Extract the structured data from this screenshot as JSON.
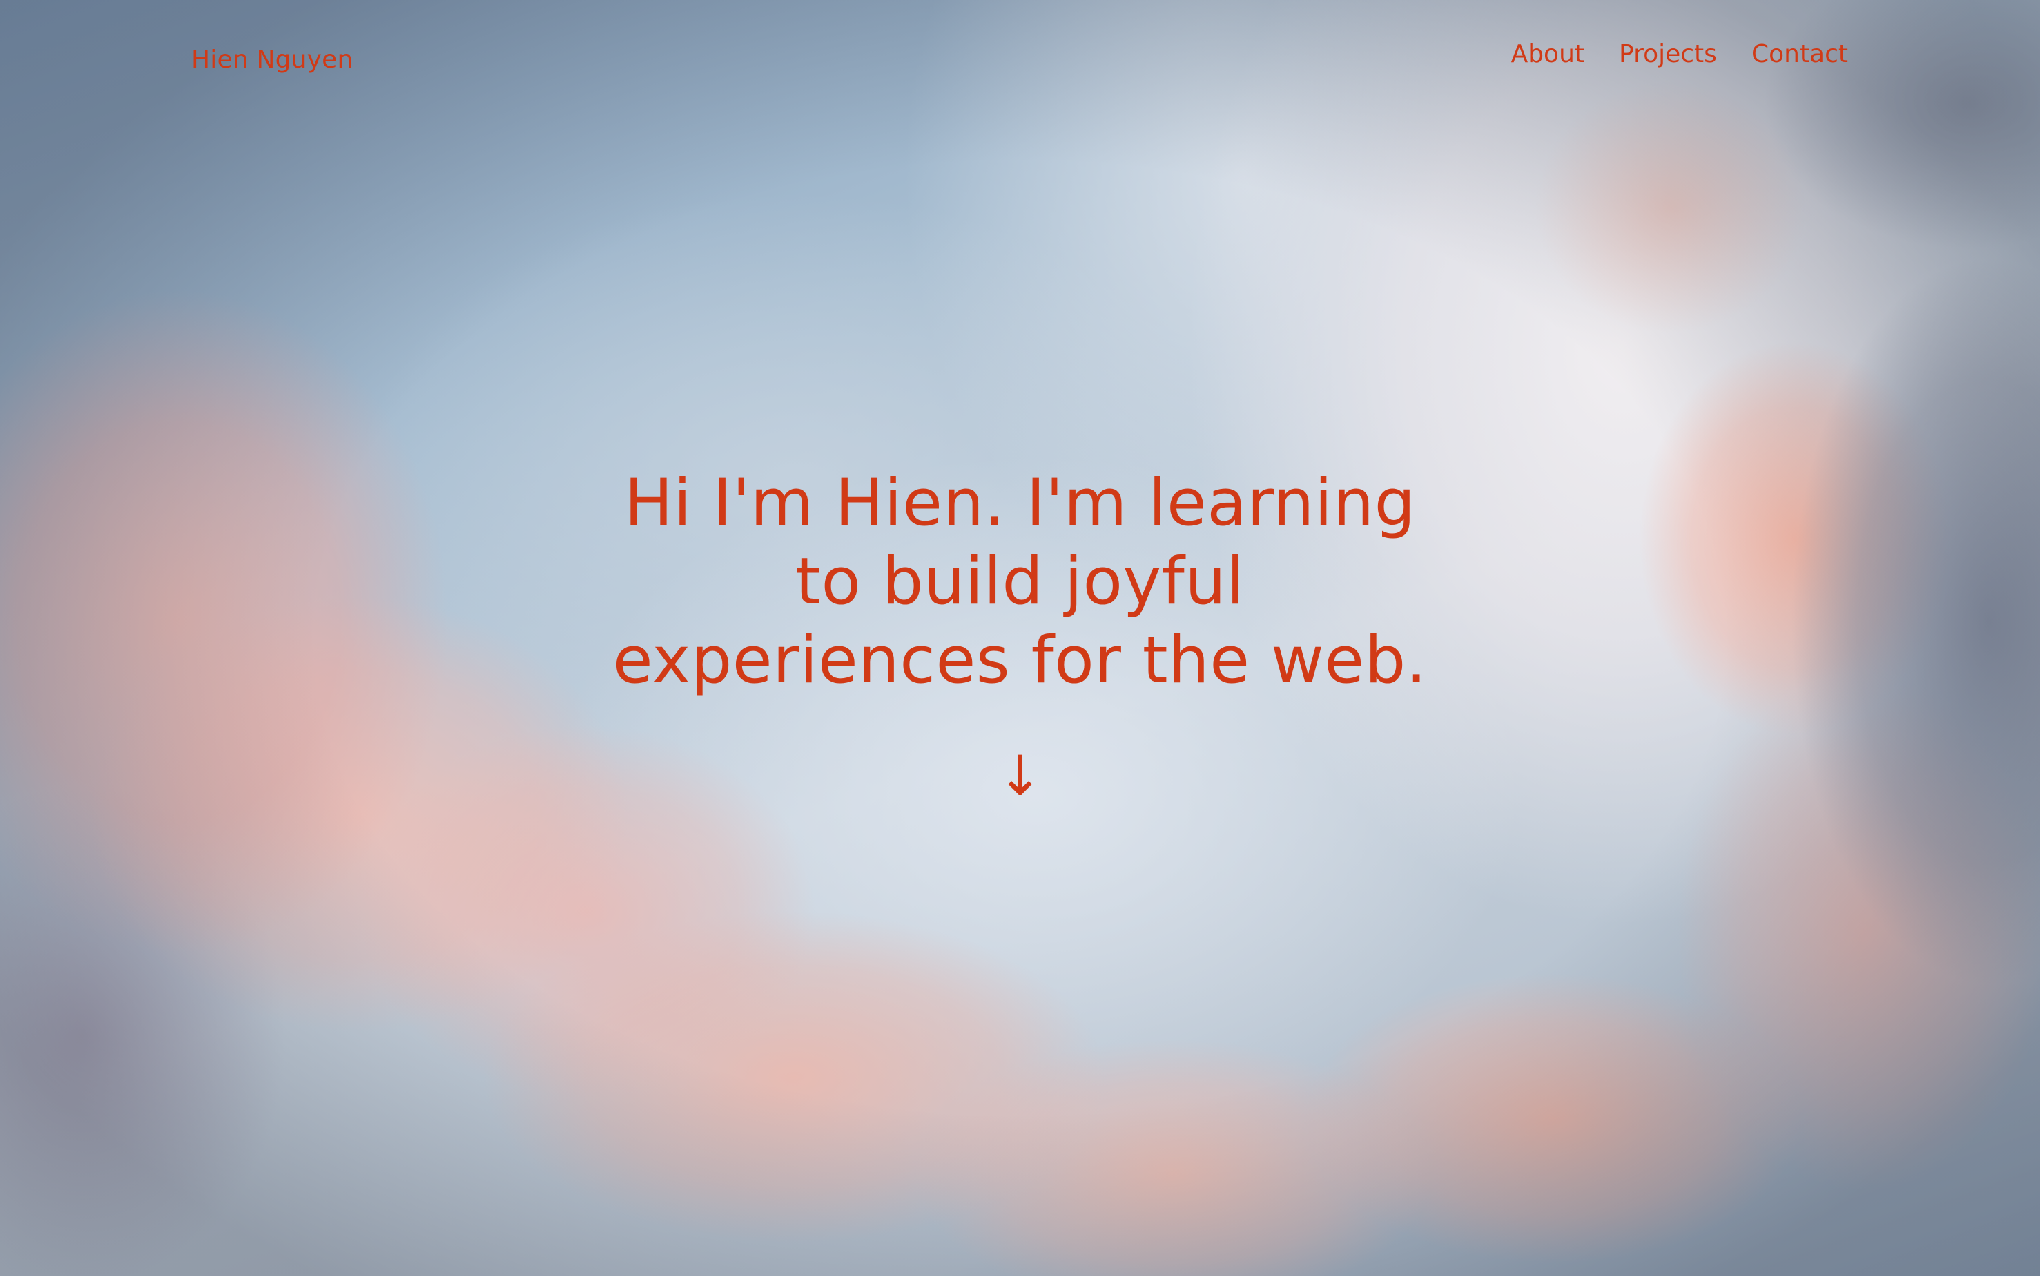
{
  "header": {
    "site_name": "Hien Nguyen",
    "nav": [
      {
        "label": "About"
      },
      {
        "label": "Projects"
      },
      {
        "label": "Contact"
      }
    ]
  },
  "hero": {
    "heading": "Hi I'm Hien. I'm learning to build joyful experiences for the web.",
    "scroll_icon_glyph": "↓"
  },
  "colors": {
    "accent": "#d13a16"
  },
  "icons": {
    "scroll": "arrow-down-icon"
  }
}
